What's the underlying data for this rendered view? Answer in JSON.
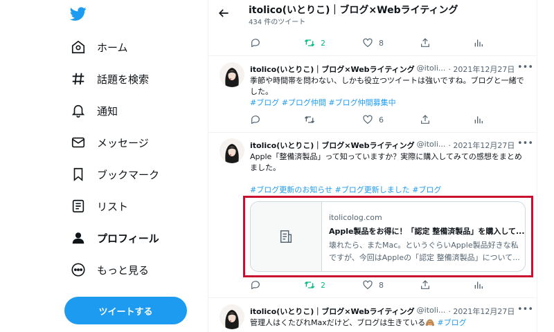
{
  "colors": {
    "twitter_blue": "#1d9bf0",
    "retweet_green": "#00ba7c",
    "highlight_red": "#c8102e"
  },
  "sidebar": {
    "logo_icon": "twitter-bird-icon",
    "items": [
      {
        "label": "ホーム",
        "icon": "home-icon"
      },
      {
        "label": "話題を検索",
        "icon": "hashtag-icon"
      },
      {
        "label": "通知",
        "icon": "bell-icon"
      },
      {
        "label": "メッセージ",
        "icon": "mail-icon"
      },
      {
        "label": "ブックマーク",
        "icon": "bookmark-icon"
      },
      {
        "label": "リスト",
        "icon": "list-icon"
      },
      {
        "label": "プロフィール",
        "icon": "person-icon"
      },
      {
        "label": "もっと見る",
        "icon": "more-circle-icon"
      }
    ],
    "tweet_button": "ツイートする"
  },
  "header": {
    "title": "itolico(いとりこ)｜ブログ×Webライティング",
    "subtitle": "434 件のツイート"
  },
  "tweets": [
    {
      "retweets": "2",
      "likes": "8"
    },
    {
      "name": "itolico(いとりこ)｜ブログ×Webライティング",
      "handle": "@itoli...",
      "date": "· 2021年12月27日",
      "text": "季節や時間帯を問わない、しかも役立つツイートは強いですね。ブログと一緒でした。",
      "hashtags": "#ブログ #ブログ仲間 #ブログ仲間募集中",
      "retweets": "",
      "likes": "6"
    },
    {
      "name": "itolico(いとりこ)｜ブログ×Webライティング",
      "handle": "@itoli...",
      "date": "· 2021年12月27日",
      "text": "Apple「整備済製品」って知っていますか？実際に購入してみての感想をまとめました。",
      "hashtags": "#ブログ更新のお知らせ #ブログ更新しました #ブログ",
      "card": {
        "domain": "itolicolog.com",
        "title": "Apple製品をお得に！「認定 整備済製品」を購入して...",
        "description": "壊れたら、またMac。というぐらいApple製品好きな私ですが、今回はAppleの「認定 整備済製品」について..."
      },
      "retweets": "2",
      "likes": "8"
    },
    {
      "name": "itolico(いとりこ)｜ブログ×Webライティング",
      "handle": "@itoli...",
      "date": "· 2021年12月27日",
      "text": "管理人はくたびれMaxだけど、ブログは生きている🙈",
      "hashtags": "#ブログ"
    }
  ]
}
